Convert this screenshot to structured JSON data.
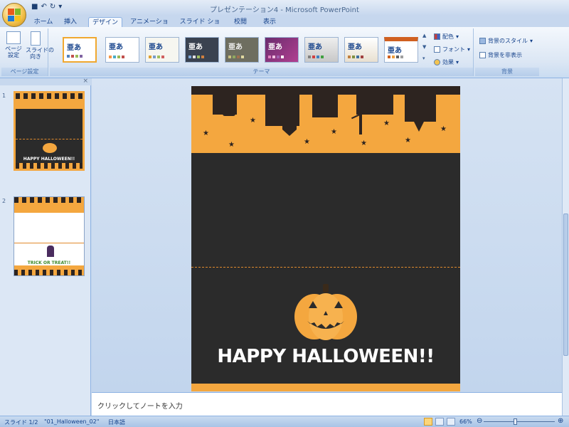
{
  "window": {
    "title": "プレゼンテーション4 - Microsoft PowerPoint"
  },
  "tabs": [
    "ホーム",
    "挿入",
    "デザイン",
    "アニメーション",
    "スライド ショー",
    "校閲",
    "表示"
  ],
  "active_tab": "デザイン",
  "ribbon": {
    "page_setup": {
      "label": "ページ設定",
      "page_setup_btn": "ページ\n設定",
      "orientation_btn": "スライドの\n向き"
    },
    "themes": {
      "label": "テーマ",
      "thumb_text": "亜あ",
      "colors_btn": "配色",
      "fonts_btn": "フォント",
      "effects_btn": "効果"
    },
    "background": {
      "label": "背景",
      "bg_style_btn": "背景のスタイル",
      "hide_bg_btn": "背景を非表示"
    }
  },
  "slides": [
    {
      "number": "1",
      "caption": "HAPPY HALLOWEEN!!"
    },
    {
      "number": "2",
      "caption": "TRICK OR TREAT!!"
    }
  ],
  "slide": {
    "headline": "HAPPY HALLOWEEN!!"
  },
  "notes": {
    "placeholder": "クリックしてノートを入力"
  },
  "status": {
    "slide_indicator": "スライド 1/2",
    "theme_name": "\"01_Halloween_02\"",
    "language": "日本語",
    "zoom": "66%"
  },
  "colors": {
    "halloween_orange": "#f4a73f",
    "slide_dark": "#2b2b2b",
    "ribbon_blue": "#15428b",
    "selection_orange": "#f3a740"
  }
}
